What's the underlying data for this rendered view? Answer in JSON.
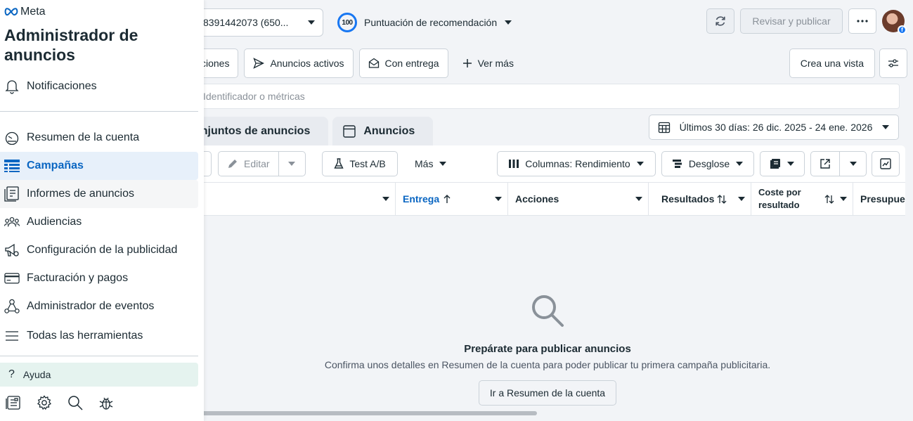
{
  "brand": {
    "logo_text": "Meta",
    "app_title": "Administrador de anuncios"
  },
  "sidebar": {
    "notifications": "Notificaciones",
    "items": [
      {
        "label": "Resumen de la cuenta",
        "icon": "gauge-icon"
      },
      {
        "label": "Campañas",
        "icon": "table-icon",
        "active": true
      },
      {
        "label": "Informes de anuncios",
        "icon": "reports-icon"
      },
      {
        "label": "Audiencias",
        "icon": "audiences-icon"
      },
      {
        "label": "Configuración de la publicidad",
        "icon": "megaphone-gear-icon"
      },
      {
        "label": "Facturación y pagos",
        "icon": "credit-card-icon"
      },
      {
        "label": "Administrador de eventos",
        "icon": "events-network-icon"
      },
      {
        "label": "Todas las herramientas",
        "icon": "hamburger-menu-icon"
      }
    ],
    "help": "Ayuda",
    "bottom_icons": [
      "ads-library-icon",
      "settings-gear-icon",
      "search-icon",
      "bug-icon"
    ]
  },
  "topbar": {
    "account_label": "8391442073 (650...",
    "score_value": "100",
    "score_label": "Puntuación de recomendación",
    "review_publish": "Revisar y publicar",
    "more_icon": "ellipsis-icon"
  },
  "filters": {
    "truncated_chip": "cciones",
    "active_ads": "Anuncios activos",
    "with_delivery": "Con entrega",
    "see_more": "Ver más",
    "create_view": "Crea una vista"
  },
  "search": {
    "placeholder": "Identificador o métricas"
  },
  "tabs": {
    "ad_sets": "onjuntos de anuncios",
    "ads": "Anuncios"
  },
  "date_range": "Últimos 30 días: 26 dic. 2025 - 24 ene. 2026",
  "toolbar": {
    "edit": "Editar",
    "ab_test": "Test A/B",
    "more": "Más",
    "columns": "Columnas: Rendimiento",
    "breakdown": "Desglose"
  },
  "table": {
    "headers": {
      "delivery": "Entrega",
      "actions": "Acciones",
      "results": "Resultados",
      "cost_per_result": "Coste por resultado",
      "budget": "Presupue..."
    }
  },
  "empty_state": {
    "title": "Prepárate para publicar anuncios",
    "message": "Confirma unos detalles en Resumen de la cuenta para poder publicar tu primera campaña publicitaria.",
    "button": "Ir a Resumen de la cuenta"
  },
  "colors": {
    "accent": "#0a66c2",
    "brand": "#1877f2",
    "help_bg": "#e5f3ef"
  }
}
